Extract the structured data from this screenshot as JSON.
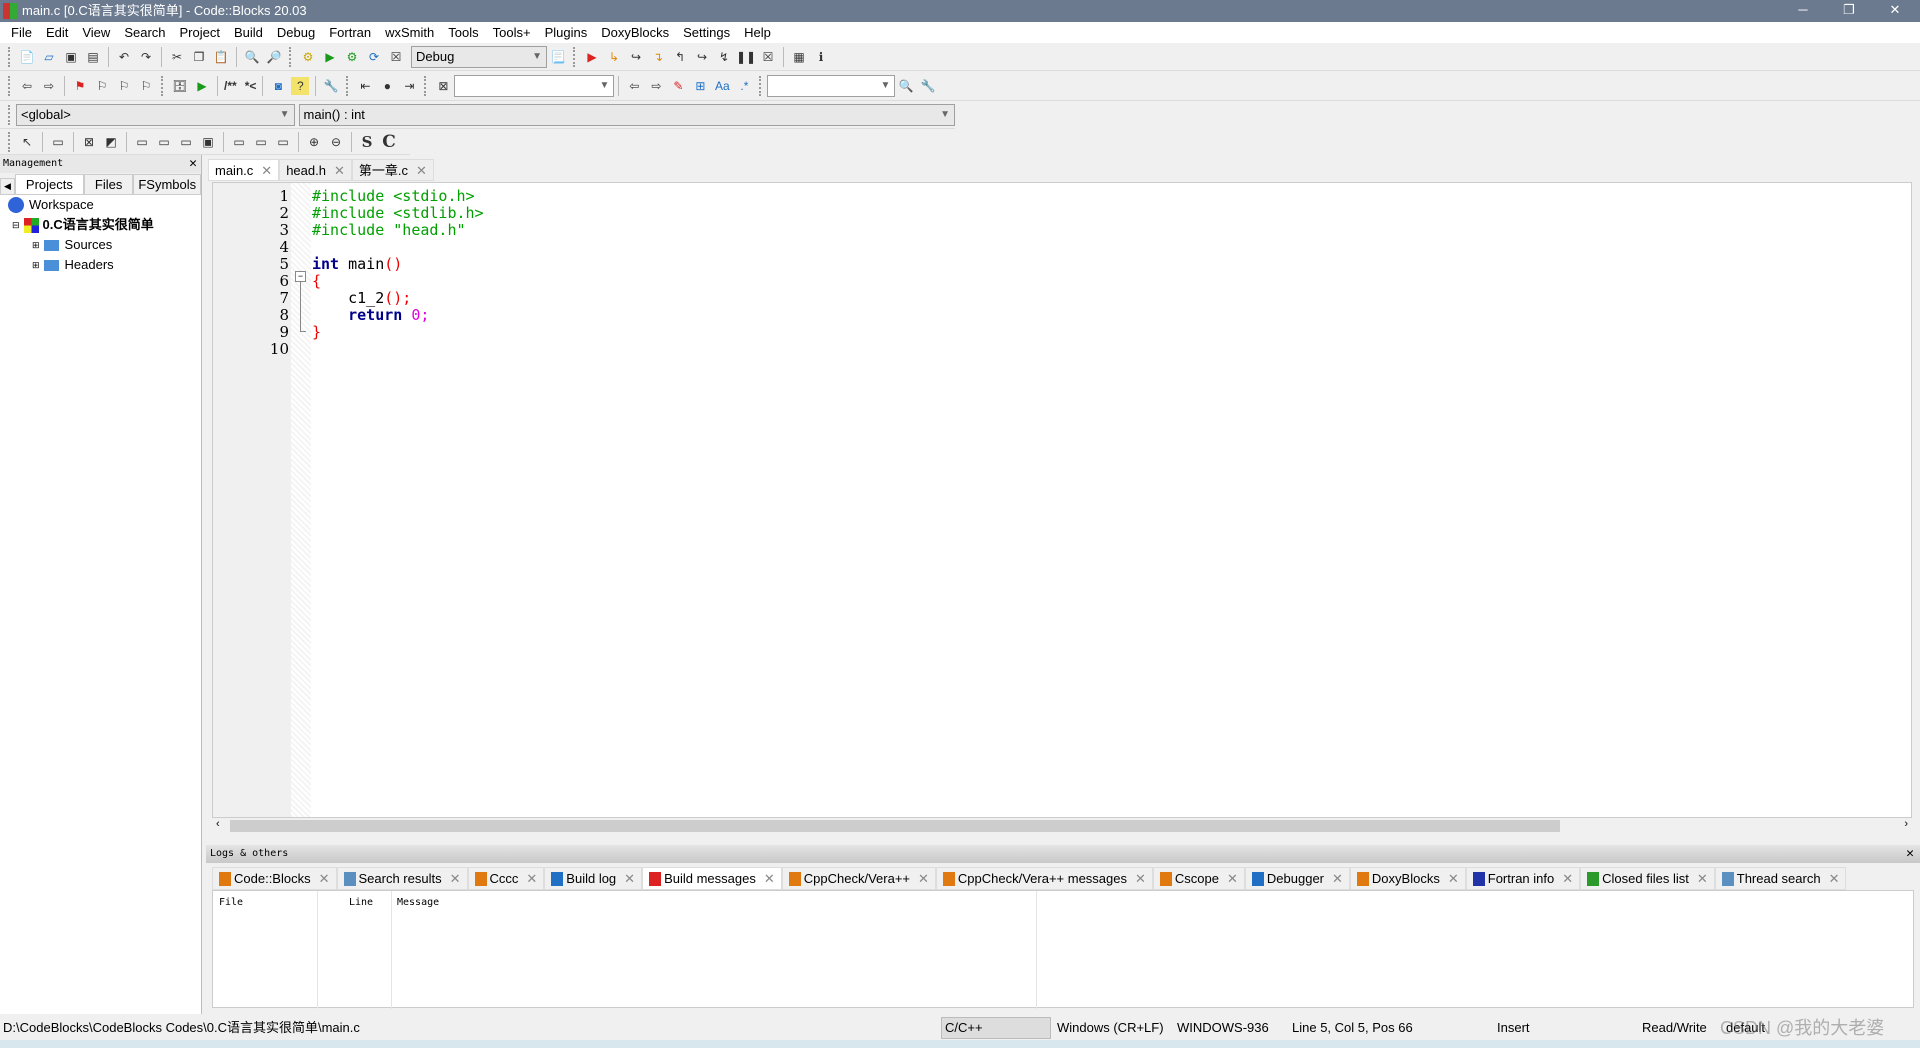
{
  "window": {
    "title": "main.c [0.C语言其实很简单] - Code::Blocks 20.03",
    "controls": [
      "─",
      "❐",
      "✕"
    ]
  },
  "menu": [
    "File",
    "Edit",
    "View",
    "Search",
    "Project",
    "Build",
    "Debug",
    "Fortran",
    "wxSmith",
    "Tools",
    "Tools+",
    "Plugins",
    "DoxyBlocks",
    "Settings",
    "Help"
  ],
  "toolbar": {
    "build_target": "Debug",
    "scope": "<global>",
    "function": "main() : int",
    "search_value": "",
    "search2_value": "",
    "comment_label": "/**",
    "comment2_label": "*<",
    "s_label": "S",
    "c_label": "C"
  },
  "management": {
    "title": "Management",
    "tabs": [
      "Projects",
      "Files",
      "FSymbols"
    ],
    "workspace": "Workspace",
    "project": "0.C语言其实很简单",
    "folders": [
      "Sources",
      "Headers"
    ]
  },
  "editor": {
    "tabs": [
      "main.c",
      "head.h",
      "第一章.c"
    ],
    "active_tab": 0,
    "lines": [
      [
        {
          "t": "#include <stdio.h>",
          "c": "pp"
        }
      ],
      [
        {
          "t": "#include <stdlib.h>",
          "c": "pp"
        }
      ],
      [
        {
          "t": "#include \"head.h\"",
          "c": "pp"
        }
      ],
      [],
      [
        {
          "t": "int",
          "c": "kw"
        },
        {
          "t": " main",
          "c": ""
        },
        {
          "t": "()",
          "c": "br"
        }
      ],
      [
        {
          "t": "{",
          "c": "br"
        }
      ],
      [
        {
          "t": "    c1_2",
          "c": ""
        },
        {
          "t": "();",
          "c": "br"
        }
      ],
      [
        {
          "t": "    return",
          "c": "kw"
        },
        {
          "t": " 0;",
          "c": "num"
        }
      ],
      [
        {
          "t": "}",
          "c": "br"
        }
      ],
      []
    ]
  },
  "logs": {
    "title": "Logs & others",
    "tabs": [
      {
        "label": "Code::Blocks",
        "icon": "pencil-doc-icon"
      },
      {
        "label": "Search results",
        "icon": "magnifier-icon"
      },
      {
        "label": "Cccc",
        "icon": "pencil-doc-icon"
      },
      {
        "label": "Build log",
        "icon": "gear-icon"
      },
      {
        "label": "Build messages",
        "icon": "pin-icon"
      },
      {
        "label": "CppCheck/Vera++",
        "icon": "pencil-doc-icon"
      },
      {
        "label": "CppCheck/Vera++ messages",
        "icon": "pencil-doc-icon"
      },
      {
        "label": "Cscope",
        "icon": "pencil-doc-icon"
      },
      {
        "label": "Debugger",
        "icon": "gear-icon"
      },
      {
        "label": "DoxyBlocks",
        "icon": "pencil-doc-icon"
      },
      {
        "label": "Fortran info",
        "icon": "fortran-doc-icon"
      },
      {
        "label": "Closed files list",
        "icon": "green-arrow-icon"
      },
      {
        "label": "Thread search",
        "icon": "magnifier-icon"
      }
    ],
    "active_tab": 4,
    "columns": [
      "File",
      "Line",
      "Message"
    ]
  },
  "status": {
    "path": "D:\\CodeBlocks\\CodeBlocks Codes\\0.C语言其实很简单\\main.c",
    "language": "C/C++",
    "eol": "Windows (CR+LF)",
    "encoding": "WINDOWS-936",
    "position": "Line 5, Col 5, Pos 66",
    "mode": "Insert",
    "access": "Read/Write",
    "profile": "default",
    "watermark": "CSDN @我的大老婆"
  }
}
